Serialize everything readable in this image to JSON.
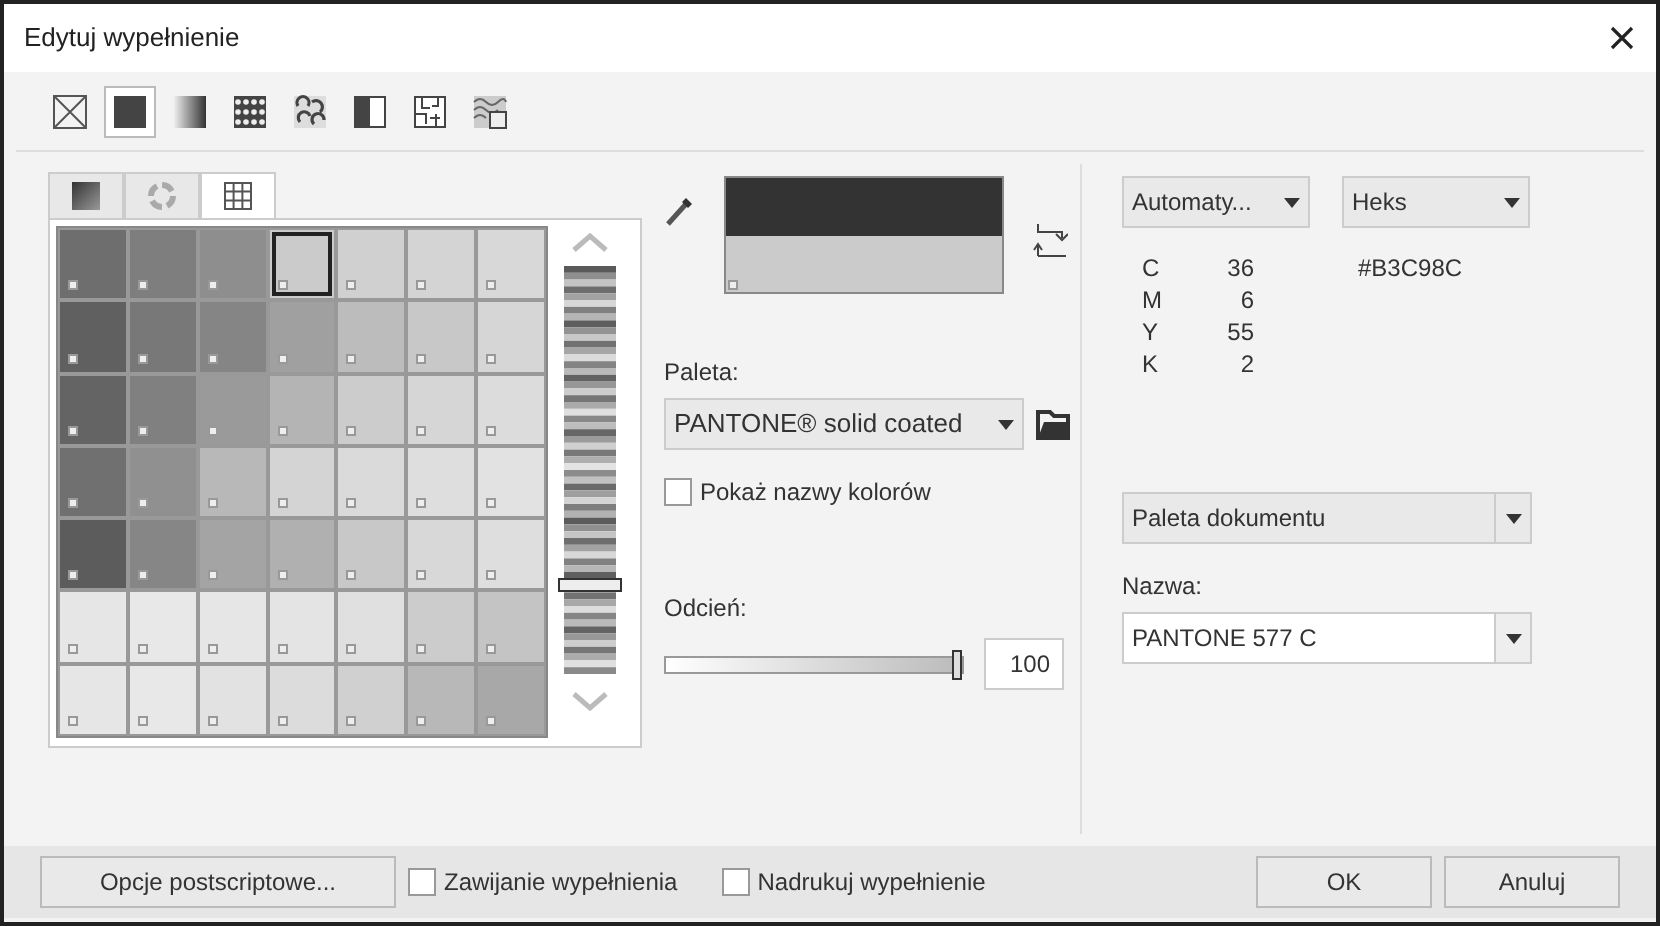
{
  "window": {
    "title": "Edytuj wypełnienie"
  },
  "fill_types": [
    {
      "kind": "none",
      "selected": false
    },
    {
      "kind": "uniform",
      "selected": true
    },
    {
      "kind": "gradient",
      "selected": false
    },
    {
      "kind": "vector",
      "selected": false
    },
    {
      "kind": "bitmap",
      "selected": false
    },
    {
      "kind": "twocolor",
      "selected": false
    },
    {
      "kind": "texture",
      "selected": false
    },
    {
      "kind": "postscript",
      "selected": false
    }
  ],
  "palette_tabs": [
    {
      "kind": "models",
      "selected": false
    },
    {
      "kind": "mixers",
      "selected": false
    },
    {
      "kind": "palettes",
      "selected": true
    }
  ],
  "swatches": [
    [
      {
        "color": "#6e6e6e",
        "selected": false
      },
      {
        "color": "#7e7e7e",
        "selected": false
      },
      {
        "color": "#8e8e8e",
        "selected": false
      },
      {
        "color": "#cbcbcb",
        "selected": true
      },
      {
        "color": "#d0d0d0",
        "selected": false
      },
      {
        "color": "#d4d4d4",
        "selected": false
      },
      {
        "color": "#d8d8d8",
        "selected": false
      }
    ],
    [
      {
        "color": "#606060",
        "selected": false
      },
      {
        "color": "#787878",
        "selected": false
      },
      {
        "color": "#858585",
        "selected": false
      },
      {
        "color": "#a0a0a0",
        "selected": false
      },
      {
        "color": "#bcbcbc",
        "selected": false
      },
      {
        "color": "#c8c8c8",
        "selected": false
      },
      {
        "color": "#d6d6d6",
        "selected": false
      }
    ],
    [
      {
        "color": "#646464",
        "selected": false
      },
      {
        "color": "#808080",
        "selected": false
      },
      {
        "color": "#9a9a9a",
        "selected": false
      },
      {
        "color": "#b4b4b4",
        "selected": false
      },
      {
        "color": "#cccccc",
        "selected": false
      },
      {
        "color": "#d6d6d6",
        "selected": false
      },
      {
        "color": "#dcdcdc",
        "selected": false
      }
    ],
    [
      {
        "color": "#707070",
        "selected": false
      },
      {
        "color": "#909090",
        "selected": false
      },
      {
        "color": "#b8b8b8",
        "selected": false
      },
      {
        "color": "#d4d4d4",
        "selected": false
      },
      {
        "color": "#dadada",
        "selected": false
      },
      {
        "color": "#dedede",
        "selected": false
      },
      {
        "color": "#e2e2e2",
        "selected": false
      }
    ],
    [
      {
        "color": "#5c5c5c",
        "selected": false
      },
      {
        "color": "#868686",
        "selected": false
      },
      {
        "color": "#a4a4a4",
        "selected": false
      },
      {
        "color": "#b0b0b0",
        "selected": false
      },
      {
        "color": "#c8c8c8",
        "selected": false
      },
      {
        "color": "#d8d8d8",
        "selected": false
      },
      {
        "color": "#dedede",
        "selected": false
      }
    ],
    [
      {
        "color": "#e6e6e6",
        "selected": false
      },
      {
        "color": "#e8e8e8",
        "selected": false
      },
      {
        "color": "#e6e6e6",
        "selected": false
      },
      {
        "color": "#e4e4e4",
        "selected": false
      },
      {
        "color": "#e0e0e0",
        "selected": false
      },
      {
        "color": "#cccccc",
        "selected": false
      },
      {
        "color": "#c4c4c4",
        "selected": false
      }
    ],
    [
      {
        "color": "#e6e6e6",
        "selected": false
      },
      {
        "color": "#e8e8e8",
        "selected": false
      },
      {
        "color": "#e2e2e2",
        "selected": false
      },
      {
        "color": "#dcdcdc",
        "selected": false
      },
      {
        "color": "#d0d0d0",
        "selected": false
      },
      {
        "color": "#b8b8b8",
        "selected": false
      },
      {
        "color": "#a8a8a8",
        "selected": false
      }
    ]
  ],
  "palette": {
    "label": "Paleta:",
    "value": "PANTONE® solid coated"
  },
  "show_names": {
    "label": "Pokaż nazwy kolorów",
    "checked": false
  },
  "tint": {
    "label": "Odcień:",
    "level": 1,
    "value": "100"
  },
  "color_model": {
    "value": "Automaty..."
  },
  "value_format": {
    "value": "Heks"
  },
  "components": [
    {
      "name": "C",
      "value": "36"
    },
    {
      "name": "M",
      "value": "6"
    },
    {
      "name": "Y",
      "value": "55"
    },
    {
      "name": "K",
      "value": "2"
    }
  ],
  "hex": "#B3C98C",
  "palette_source": {
    "value": "Paleta dokumentu"
  },
  "name": {
    "label": "Nazwa:",
    "value": "PANTONE 577 C"
  },
  "footer": {
    "postscript_button": "Opcje postscriptowe...",
    "options": [
      {
        "label": "Zawijanie wypełnienia",
        "checked": false
      },
      {
        "label": "Nadrukuj wypełnienie",
        "checked": false
      }
    ],
    "ok": "OK",
    "cancel": "Anuluj"
  }
}
